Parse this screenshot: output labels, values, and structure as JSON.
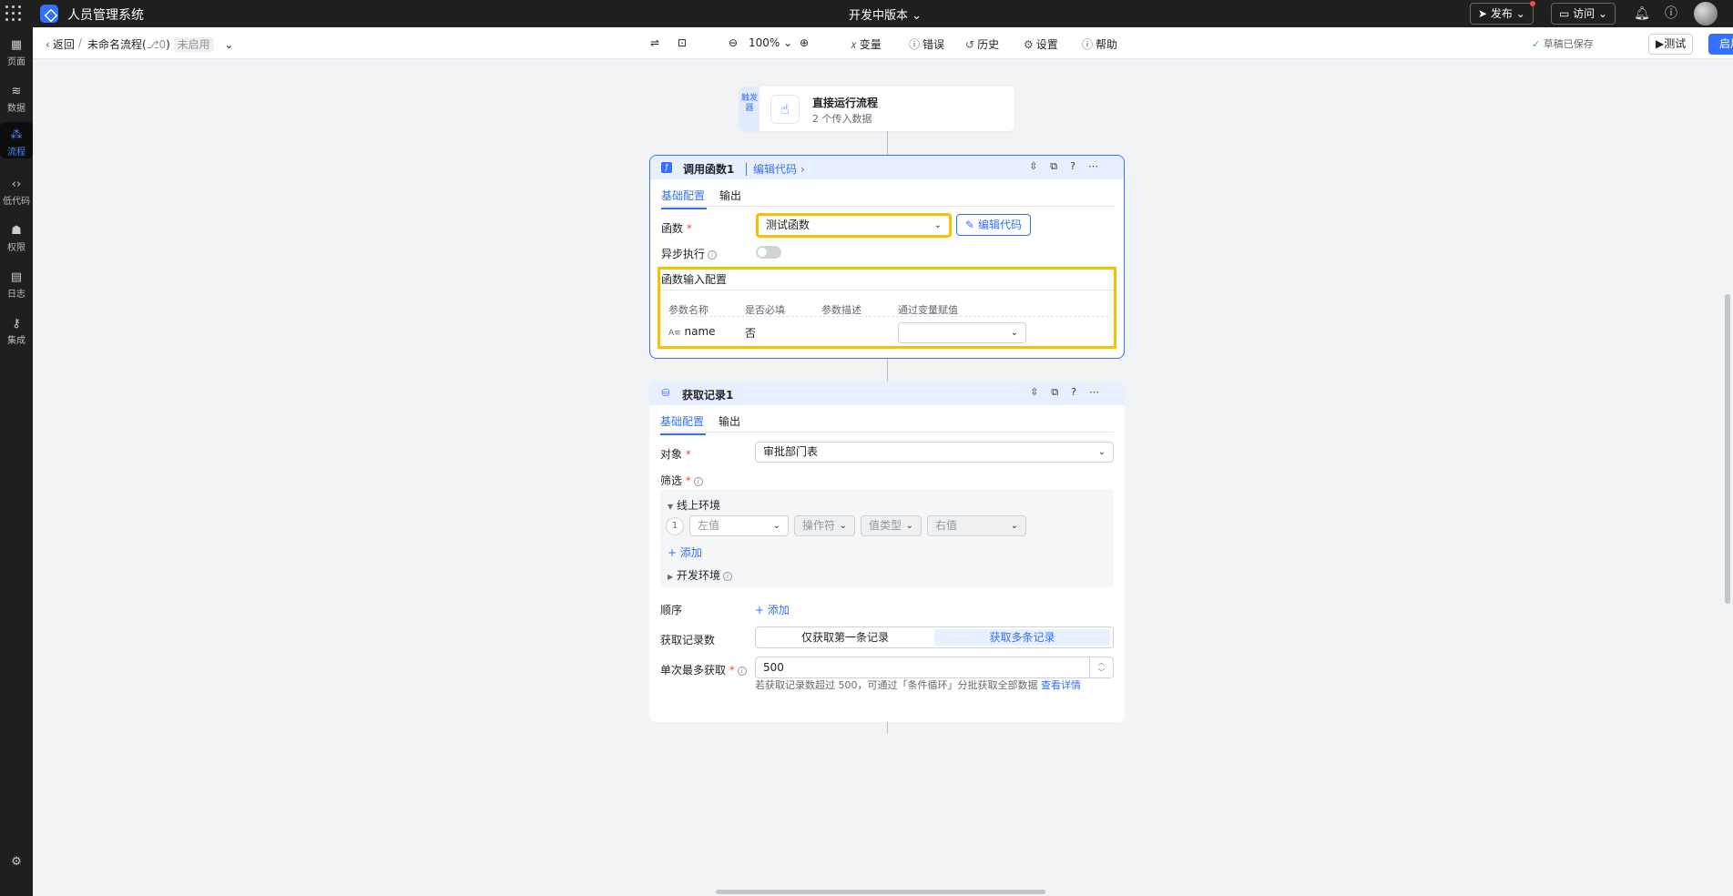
{
  "topbar": {
    "app_name": "人员管理系统",
    "version": "开发中版本 ⌄",
    "publish": "发布",
    "visit": "访问"
  },
  "sidebar": [
    {
      "label": "页面",
      "icon": "pages-icon"
    },
    {
      "label": "数据",
      "icon": "database-icon"
    },
    {
      "label": "流程",
      "icon": "flow-icon"
    },
    {
      "label": "低代码",
      "icon": "code-icon"
    },
    {
      "label": "权限",
      "icon": "users-icon"
    },
    {
      "label": "日志",
      "icon": "log-icon"
    },
    {
      "label": "集成",
      "icon": "key-icon"
    }
  ],
  "toolbar": {
    "back": "返回",
    "flow_name": "未命名流程(",
    "flow_count": "0",
    "flow_close": ")",
    "status": "未启用",
    "zoom": "100%",
    "variables": "变量",
    "errors": "错误",
    "history": "历史",
    "settings": "设置",
    "help": "帮助",
    "saved": "草稿已保存",
    "test": "测试",
    "enable": "启用"
  },
  "trigger": {
    "tag": "触发器",
    "title": "直接运行流程",
    "subtitle": "2 个传入数据"
  },
  "card1": {
    "title": "调用函数1",
    "edit_link": "编辑代码",
    "tab_basic": "基础配置",
    "tab_output": "输出",
    "func_label": "函数",
    "func_value": "测试函数",
    "edit_button": "编辑代码",
    "async_label": "异步执行",
    "async_on": false,
    "input_title": "函数输入配置",
    "headers": [
      "参数名称",
      "是否必填",
      "参数描述",
      "通过变量赋值"
    ],
    "row": {
      "type": "A≡",
      "name": "name",
      "required": "否",
      "desc": ""
    }
  },
  "card2": {
    "title": "获取记录1",
    "tab_basic": "基础配置",
    "tab_output": "输出",
    "object_label": "对象",
    "object_value": "审批部门表",
    "filter_label": "筛选",
    "env_online": "线上环境",
    "cond_index": "1",
    "left": "左值",
    "op": "操作符",
    "vtype": "值类型",
    "right": "右值",
    "add": "添加",
    "env_dev": "开发环境",
    "order_label": "顺序",
    "order_add": "添加",
    "count_label": "获取记录数",
    "count_first": "仅获取第一条记录",
    "count_multi": "获取多条记录",
    "max_label": "单次最多获取",
    "max_value": "500",
    "hint_text": "若获取记录数超过 500，可通过「条件循环」分批获取全部数据",
    "hint_link": "查看详情"
  }
}
